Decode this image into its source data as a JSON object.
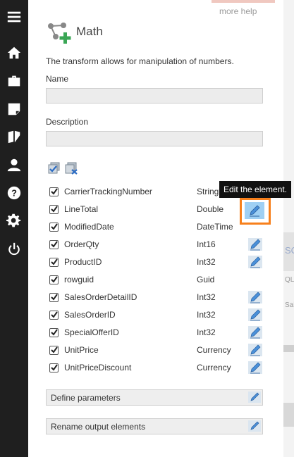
{
  "nav": {
    "items": [
      "menu-icon",
      "home-icon",
      "briefcase-icon",
      "note-icon",
      "book-icon",
      "user-icon",
      "help-icon",
      "settings-icon",
      "power-icon"
    ]
  },
  "header": {
    "more_help": "more help",
    "title": "Math",
    "description": "The transform allows for manipulation of numbers."
  },
  "form": {
    "name_label": "Name",
    "name_value": "",
    "description_label": "Description",
    "description_value": ""
  },
  "fields": [
    {
      "name": "CarrierTrackingNumber",
      "type": "String",
      "checked": true,
      "editable": false
    },
    {
      "name": "LineTotal",
      "type": "Double",
      "checked": true,
      "editable": true
    },
    {
      "name": "ModifiedDate",
      "type": "DateTime",
      "checked": true,
      "editable": false
    },
    {
      "name": "OrderQty",
      "type": "Int16",
      "checked": true,
      "editable": true
    },
    {
      "name": "ProductID",
      "type": "Int32",
      "checked": true,
      "editable": true
    },
    {
      "name": "rowguid",
      "type": "Guid",
      "checked": true,
      "editable": false
    },
    {
      "name": "SalesOrderDetailID",
      "type": "Int32",
      "checked": true,
      "editable": true
    },
    {
      "name": "SalesOrderID",
      "type": "Int32",
      "checked": true,
      "editable": true
    },
    {
      "name": "SpecialOfferID",
      "type": "Int32",
      "checked": true,
      "editable": true
    },
    {
      "name": "UnitPrice",
      "type": "Currency",
      "checked": true,
      "editable": true
    },
    {
      "name": "UnitPriceDiscount",
      "type": "Currency",
      "checked": true,
      "editable": true
    }
  ],
  "tooltip": "Edit the element.",
  "sections": {
    "define_parameters": "Define parameters",
    "rename_output": "Rename output elements"
  },
  "background_fragments": {
    "sc": "SC",
    "ql": "QL",
    "sale": "Sale"
  },
  "colors": {
    "nav_bg": "#1f1f1f",
    "highlight": "#f7801c",
    "edit_icon_blue": "#4a90d9",
    "add_icon_green": "#3aa655"
  }
}
